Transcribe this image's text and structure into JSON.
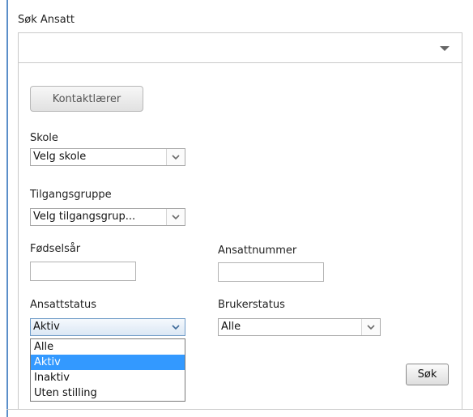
{
  "search_panel": {
    "title": "Søk Ansatt",
    "combo_value": ""
  },
  "contact_teachers_button": "Kontaktlærer",
  "school": {
    "label": "Skole",
    "selected": "Velg skole"
  },
  "access_group": {
    "label": "Tilgangsgruppe",
    "selected": "Velg tilgangsgrup..."
  },
  "birth_year": {
    "label": "Fødselsår",
    "value": ""
  },
  "employee_number": {
    "label": "Ansattnummer",
    "value": ""
  },
  "employee_status": {
    "label": "Ansattstatus",
    "selected": "Aktiv",
    "options": [
      "Alle",
      "Aktiv",
      "Inaktiv",
      "Uten stilling"
    ]
  },
  "user_status": {
    "label": "Brukerstatus",
    "selected": "Alle"
  },
  "search_button": "Søk",
  "icons": {
    "combo": "caret-down-icon",
    "select": "chevron-down-icon"
  },
  "colors": {
    "frame_accent": "#5b8fc9",
    "highlight": "#3399ff"
  }
}
